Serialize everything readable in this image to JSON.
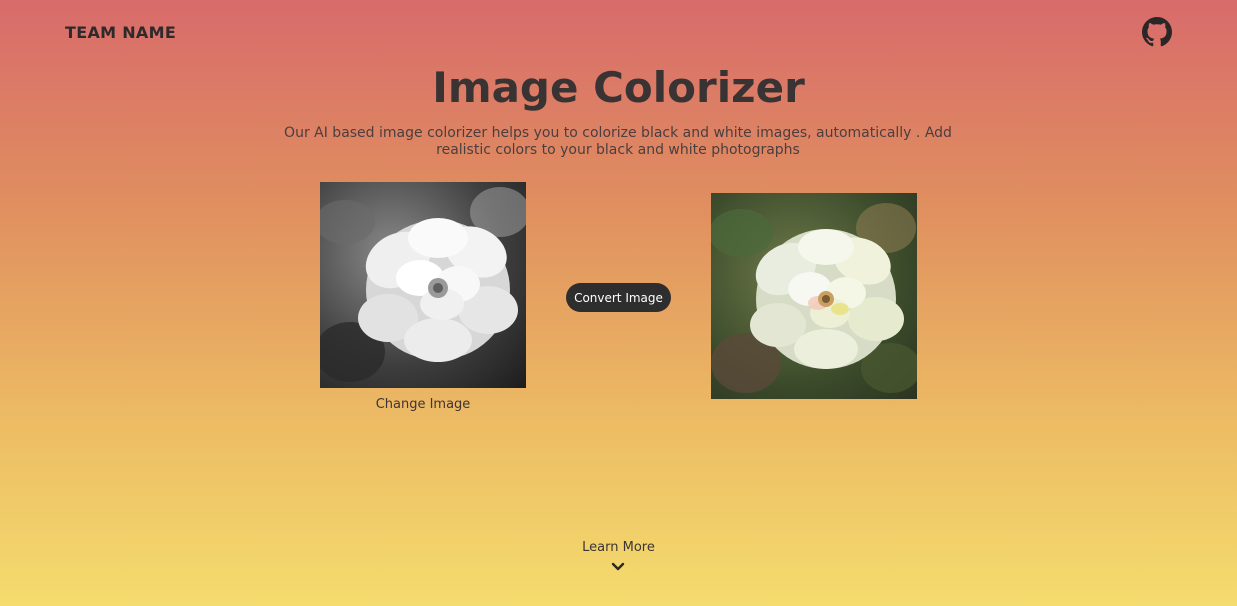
{
  "header": {
    "brand": "TEAM NAME",
    "github_icon": "github-icon"
  },
  "hero": {
    "title": "Image Colorizer",
    "subtitle": "Our AI based image colorizer helps you to colorize black and white images, automatically . Add realistic colors to your black and white photographs"
  },
  "converter": {
    "input_image": "black-and-white-flower-photo",
    "output_image": "colorized-flower-photo",
    "change_label": "Change Image",
    "convert_label": "Convert Image"
  },
  "footer": {
    "learn_more_label": "Learn More",
    "chevron_icon": "chevron-down-icon"
  },
  "colors": {
    "gradient_top": "#d86b6b",
    "gradient_bottom": "#f4dc6e",
    "button_bg": "#2f2e2f",
    "text_dark": "#3a3333"
  }
}
